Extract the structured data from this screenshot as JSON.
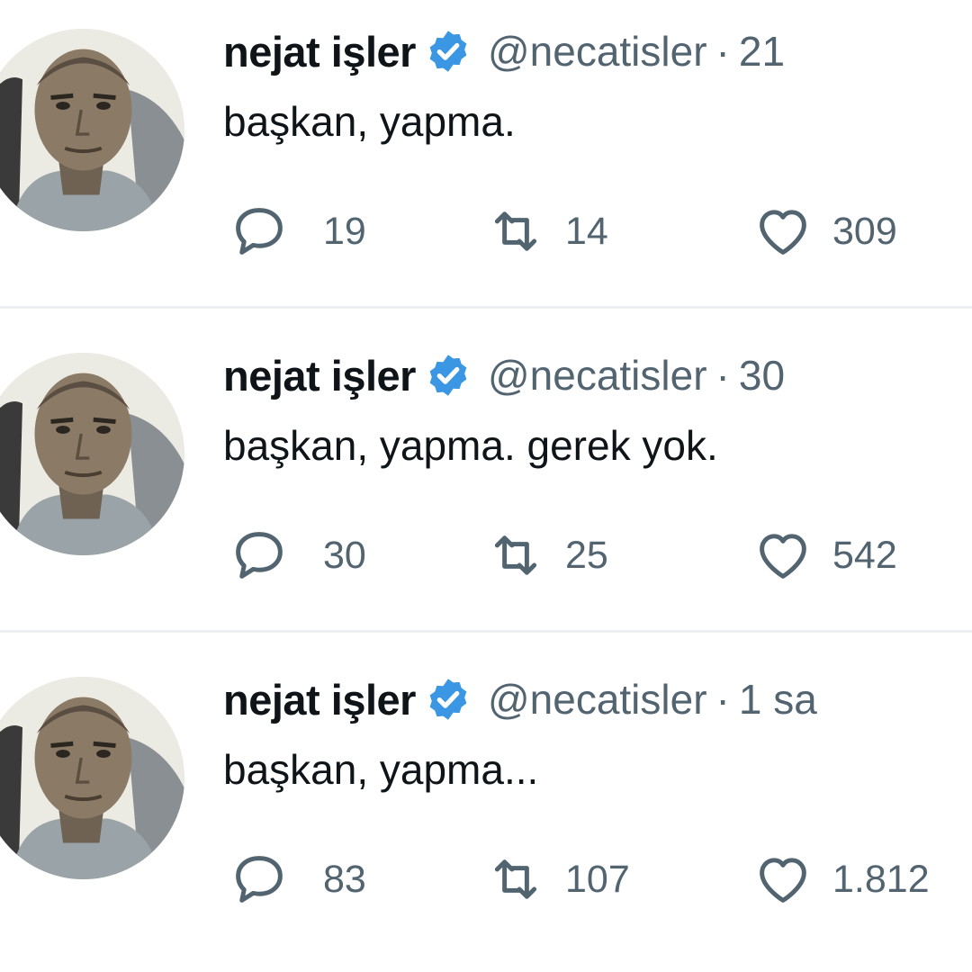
{
  "tweets": [
    {
      "name": "nejat işler",
      "handle": "@necatisler",
      "separator": "·",
      "time": "21",
      "text": "başkan, yapma.",
      "replies": "19",
      "retweets": "14",
      "likes": "309"
    },
    {
      "name": "nejat işler",
      "handle": "@necatisler",
      "separator": "·",
      "time": "30",
      "text": "başkan, yapma. gerek yok.",
      "replies": "30",
      "retweets": "25",
      "likes": "542"
    },
    {
      "name": "nejat işler",
      "handle": "@necatisler",
      "separator": "·",
      "time": "1 sa",
      "text": "başkan, yapma...",
      "replies": "83",
      "retweets": "107",
      "likes": "1.812"
    }
  ],
  "colors": {
    "verified": "#3b97e3",
    "muted_text": "#536471",
    "primary_text": "#0f1419",
    "divider": "#eceff1"
  },
  "icons": {
    "verified": "verified-badge-icon",
    "reply": "reply-bubble-icon",
    "retweet": "retweet-icon",
    "like": "heart-icon"
  }
}
